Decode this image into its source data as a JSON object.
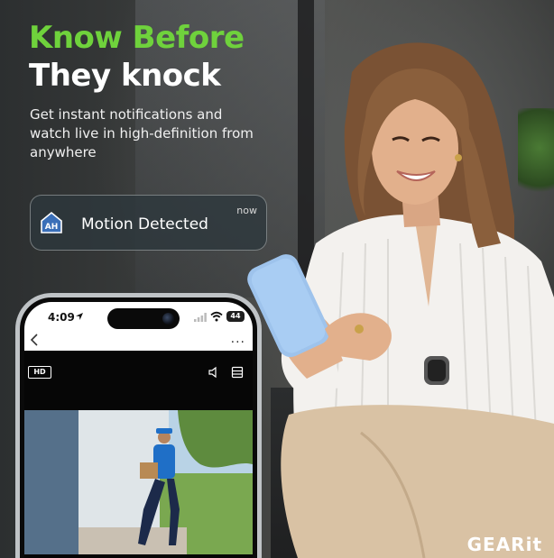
{
  "headline": {
    "line1": "Know Before",
    "line2": "They knock"
  },
  "subtitle": "Get instant notifications and watch live in high-definition from anywhere",
  "notification": {
    "title": "Motion Detected",
    "time": "now",
    "app_icon_text": "AH"
  },
  "phone": {
    "status_time": "4:09",
    "battery": "44",
    "hd_label": "HD",
    "more": "..."
  },
  "brand": {
    "logo_text": "GEARit"
  },
  "colors": {
    "accent_green": "#6fd23c",
    "notification_bg": "#2d373c",
    "text_white": "#ffffff"
  },
  "icons": [
    "house-app-icon",
    "location-arrow-icon",
    "camera-icon",
    "signal-icon",
    "wifi-icon",
    "battery-icon",
    "back-chevron-icon",
    "more-dots-icon",
    "speaker-icon",
    "storage-icon"
  ]
}
